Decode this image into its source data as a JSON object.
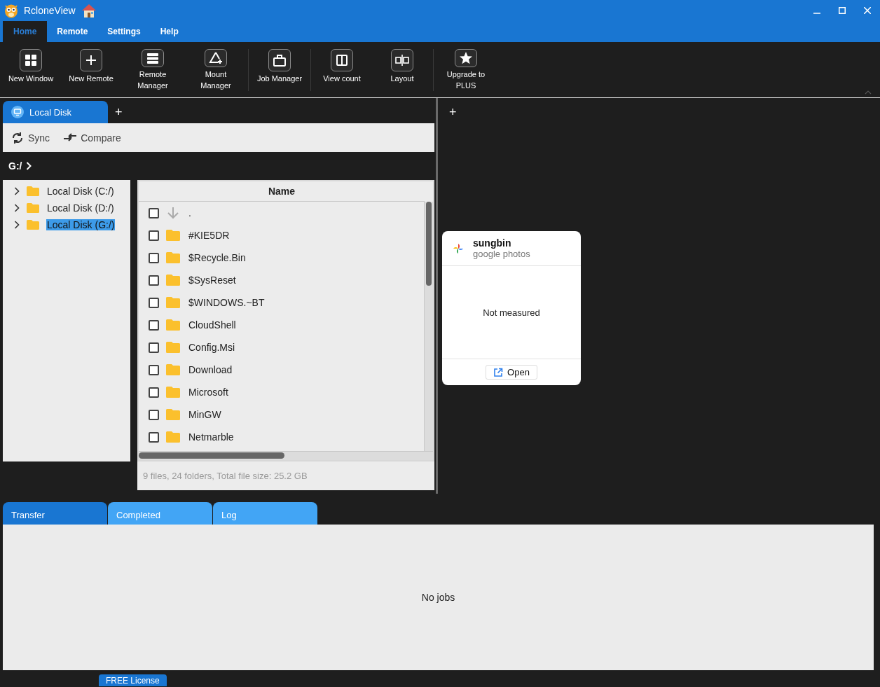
{
  "window": {
    "title": "RcloneView"
  },
  "menu_tabs": [
    {
      "label": "Home",
      "selected": true
    },
    {
      "label": "Remote",
      "selected": false
    },
    {
      "label": "Settings",
      "selected": false
    },
    {
      "label": "Help",
      "selected": false
    }
  ],
  "ribbon_groups": [
    [
      {
        "label": "New Window",
        "kind": "grid"
      },
      {
        "label": "New Remote",
        "kind": "plus"
      },
      {
        "label": "Remote Manager",
        "kind": "list"
      },
      {
        "label": "Mount Manager",
        "kind": "mount"
      }
    ],
    [
      {
        "label": "Job Manager",
        "kind": "job"
      }
    ],
    [
      {
        "label": "View count",
        "kind": "columns"
      },
      {
        "label": "Layout",
        "kind": "layout"
      }
    ],
    [
      {
        "label": "Upgrade to PLUS",
        "kind": "star"
      }
    ]
  ],
  "left_pane": {
    "tabs": [
      {
        "label": "Local Disk",
        "selected": true
      }
    ],
    "add_tab": "+",
    "toolbar": [
      {
        "label": "Sync",
        "kind": "sync"
      },
      {
        "label": "Compare",
        "kind": "compare"
      }
    ],
    "path": "G:/",
    "tree": [
      {
        "label": "Local Disk (C:/)",
        "selected": false,
        "expanded": false
      },
      {
        "label": "Local Disk (D:/)",
        "selected": false,
        "expanded": false
      },
      {
        "label": "Local Disk (G:/)",
        "selected": true,
        "expanded": false
      }
    ],
    "table": {
      "columns": [
        "Name"
      ],
      "rows": [
        {
          "name": ".",
          "kind": "parent",
          "checked": false
        },
        {
          "name": "#KIE5DR",
          "kind": "folder",
          "checked": false
        },
        {
          "name": "$Recycle.Bin",
          "kind": "folder",
          "checked": false
        },
        {
          "name": "$SysReset",
          "kind": "folder",
          "checked": false
        },
        {
          "name": "$WINDOWS.~BT",
          "kind": "folder",
          "checked": false
        },
        {
          "name": "CloudShell",
          "kind": "folder",
          "checked": false
        },
        {
          "name": "Config.Msi",
          "kind": "folder",
          "checked": false
        },
        {
          "name": "Download",
          "kind": "folder",
          "checked": false
        },
        {
          "name": "Microsoft",
          "kind": "folder",
          "checked": false
        },
        {
          "name": "MinGW",
          "kind": "folder",
          "checked": false
        },
        {
          "name": "Netmarble",
          "kind": "folder",
          "checked": false
        }
      ]
    },
    "status": "9 files, 24 folders, Total file size: 25.2 GB"
  },
  "right_pane": {
    "add_tab": "+",
    "remote_card": {
      "name": "sungbin",
      "type": "google photos",
      "usage": "Not measured",
      "button": "Open"
    }
  },
  "bottom_tabs": [
    {
      "label": "Transfer",
      "selected": true
    },
    {
      "label": "Completed",
      "selected": false
    },
    {
      "label": "Log",
      "selected": false
    }
  ],
  "jobs": {
    "empty_text": "No jobs"
  },
  "footer": {
    "license": "FREE License"
  }
}
